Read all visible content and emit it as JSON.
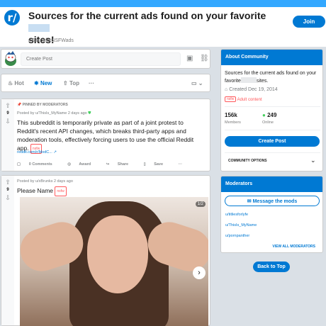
{
  "header": {
    "icon_text": "r/",
    "title_line1": "Sources for the current ads found on your favorite",
    "title_line2": "sites!",
    "subreddit": "r/SauceforNSFWads",
    "join_label": "Join"
  },
  "create_post": {
    "placeholder": "Create Post"
  },
  "sort": {
    "hot": "Hot",
    "new": "New",
    "top": "Top",
    "more": "···"
  },
  "posts": [
    {
      "pinned_label": "PINNED BY MODERATORS",
      "meta": "Posted by u/ThisIs_MyName 2 days ago",
      "score": "9",
      "title": "This subreddit is temporarily private as part of a joint protest to Reddit's recent API changes, which breaks third-party apps and moderation tools, effectively forcing users to use the official Reddit app.",
      "flair": "nsfw",
      "link": "reddit.com/r/ModC...",
      "actions": {
        "comments": "0 Comments",
        "award": "Award",
        "share": "Share",
        "save": "Save",
        "more": "···"
      }
    },
    {
      "meta": "Posted by u/xBrunks 2 days ago",
      "score": "9",
      "title": "Please Name",
      "flair": "nsfw",
      "gallery_counter": "1/2"
    }
  ],
  "about": {
    "heading": "About Community",
    "desc_part1": "Sources for the current ads found on your",
    "desc_part2": "favorite",
    "desc_part3": "sites.",
    "created": "Created Dec 19, 2014",
    "nsfw": "nsfw",
    "adult": "Adult content",
    "members_count": "156k",
    "members_label": "Members",
    "online_count": "249",
    "online_label": "Online",
    "create_post": "Create Post",
    "community_options": "COMMUNITY OPTIONS"
  },
  "moderators": {
    "heading": "Moderators",
    "message_btn": "Message the mods",
    "list": [
      "u/titliesforlyfe",
      "u/ThisIs_MyName",
      "u/pornpanther"
    ],
    "view_all": "VIEW ALL MODERATORS"
  },
  "back_to_top": "Back to Top",
  "colors": {
    "accent": "#0079d3",
    "nsfw": "#ff585b",
    "online": "#46d160"
  }
}
